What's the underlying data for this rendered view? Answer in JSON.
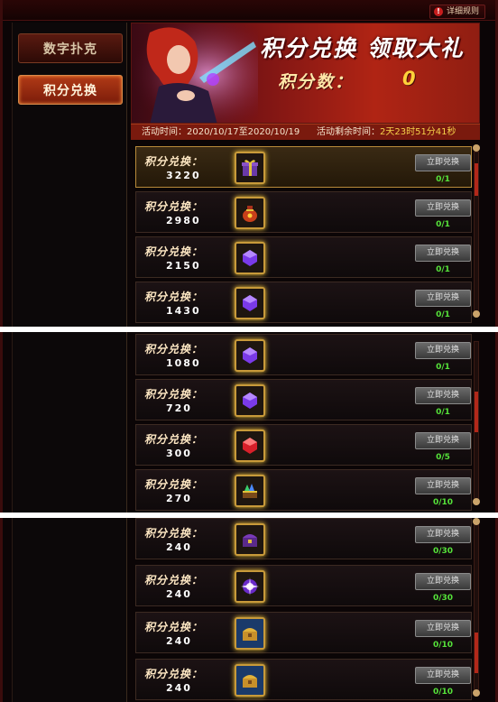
{
  "header": {
    "rules_label": "详细规则"
  },
  "nav": {
    "items": [
      {
        "label": "数字扑克"
      },
      {
        "label": "积分兑换"
      }
    ]
  },
  "banner": {
    "title": "积分兑换 领取大礼",
    "score_label": "积分数：",
    "score_value": "0"
  },
  "info": {
    "time_label": "活动时间：2020/10/17至2020/10/19",
    "remain_label": "活动剩余时间：",
    "remain_value": "2天23时51分41秒"
  },
  "colors": {
    "accent": "#b02414",
    "gold": "#ffd23a",
    "count_green": "#55e23a"
  },
  "rows": [
    {
      "label": "积分兑换：",
      "points": "3220",
      "button": "立即兑换",
      "count": "0/1",
      "icon": "gift-box-icon"
    },
    {
      "label": "积分兑换：",
      "points": "2980",
      "button": "立即兑换",
      "count": "0/1",
      "icon": "treasure-bag-icon"
    },
    {
      "label": "积分兑换：",
      "points": "2150",
      "button": "立即兑换",
      "count": "0/1",
      "icon": "purple-gem-icon"
    },
    {
      "label": "积分兑换：",
      "points": "1430",
      "button": "立即兑换",
      "count": "0/1",
      "icon": "purple-gem-icon"
    },
    {
      "label": "积分兑换：",
      "points": "1080",
      "button": "立即兑换",
      "count": "0/1",
      "icon": "purple-gem-icon"
    },
    {
      "label": "积分兑换：",
      "points": "720",
      "button": "立即兑换",
      "count": "0/1",
      "icon": "purple-gem-icon"
    },
    {
      "label": "积分兑换：",
      "points": "300",
      "button": "立即兑换",
      "count": "0/5",
      "icon": "red-gem-icon"
    },
    {
      "label": "积分兑换：",
      "points": "270",
      "button": "立即兑换",
      "count": "0/10",
      "icon": "gem-chest-icon"
    },
    {
      "label": "积分兑换：",
      "points": "240",
      "button": "立即兑换",
      "count": "0/30",
      "icon": "purple-chest-icon"
    },
    {
      "label": "积分兑换：",
      "points": "240",
      "button": "立即兑换",
      "count": "0/30",
      "icon": "purple-orb-icon"
    },
    {
      "label": "积分兑换：",
      "points": "240",
      "button": "立即兑换",
      "count": "0/10",
      "icon": "gold-chest-icon"
    },
    {
      "label": "积分兑换：",
      "points": "240",
      "button": "立即兑换",
      "count": "0/10",
      "icon": "gold-chest-icon"
    }
  ]
}
